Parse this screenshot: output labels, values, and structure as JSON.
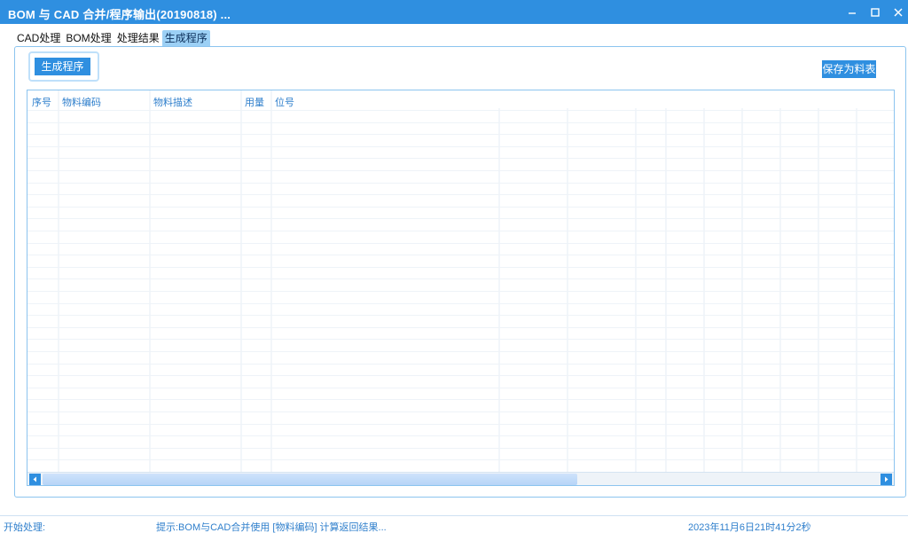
{
  "window": {
    "title": "BOM 与 CAD 合并/程序输出(20190818) ...",
    "controls": [
      "minimize-icon",
      "maximize-icon",
      "close-icon"
    ]
  },
  "tabs": [
    {
      "label": "CAD处理",
      "active": false
    },
    {
      "label": "BOM处理",
      "active": false
    },
    {
      "label": "处理结果",
      "active": false
    },
    {
      "label": "生成程序",
      "active": true
    }
  ],
  "toolbar": {
    "generate_label": "生成程序",
    "save_label": "保存为料表"
  },
  "grid": {
    "columns": [
      "序号",
      "物料编码",
      "物料描述",
      "用量",
      "位号"
    ],
    "rows": []
  },
  "status": {
    "left": "开始处理:",
    "hint": "提示:BOM与CAD合并使用 [物料编码] 计算返回结果...",
    "datetime": "2023年11月6日21时41分2秒"
  },
  "colors": {
    "accent": "#2f8fe0",
    "active_tab": "#9cd0f5",
    "border": "#8cc4ef",
    "header_text": "#2f7fcc"
  }
}
